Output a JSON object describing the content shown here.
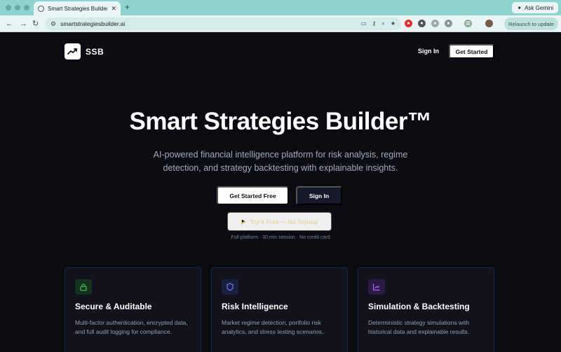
{
  "browser": {
    "tab_title": "Smart Strategies Builder (SSB",
    "new_tab_label": "+",
    "ask_gemini": "Ask Gemini",
    "url": "smartstrategiesbuilder.ai",
    "relaunch_label": "Relaunch to update"
  },
  "nav": {
    "logo_text": "SSB",
    "signin_label": "Sign In",
    "get_started_label": "Get Started"
  },
  "hero": {
    "title": "Smart Strategies Builder™",
    "subtitle": "AI-powered financial intelligence platform for risk analysis, regime detection, and strategy backtesting with explainable insights.",
    "primary_cta": "Get Started Free",
    "secondary_cta": "Sign In",
    "try_cta": "Try It Free — No Signup",
    "fineprint": "Full platform · 30 min session · No credit card"
  },
  "features": [
    {
      "icon": "lock-icon",
      "accent": "#4caf50",
      "title": "Secure & Auditable",
      "description": "Multi-factor authentication, encrypted data, and full audit logging for compliance."
    },
    {
      "icon": "shield-icon",
      "accent": "#6b7cff",
      "title": "Risk Intelligence",
      "description": "Market regime detection, portfolio risk analytics, and stress testing scenarios."
    },
    {
      "icon": "chart-icon",
      "accent": "#a56cff",
      "title": "Simulation & Backtesting",
      "description": "Deterministic strategy simulations with historical data and explainable results."
    }
  ]
}
